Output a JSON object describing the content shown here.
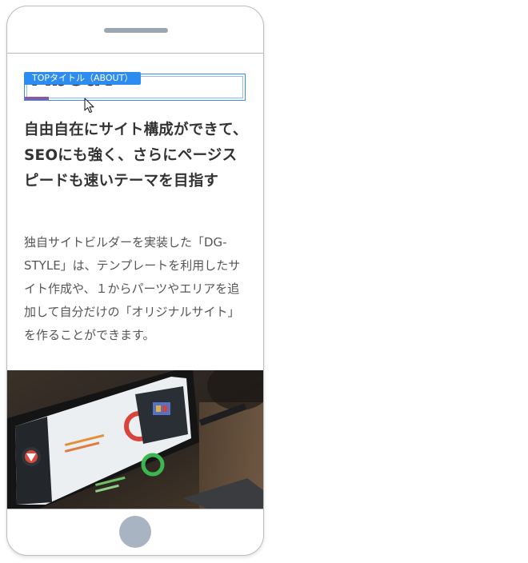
{
  "screen": {
    "about_title": "About",
    "selection_label": "TOPタイトル（ABOUT）",
    "subheading": "自由自在にサイト構成ができて、SEOにも強く、さらにページスピードも速いテーマを目指す",
    "body": "独自サイトビルダーを実装した「DG-STYLE」は、テンプレートを利用したサイト作成や、１からパーツやエリアを追加して自分だけの「オリジナルサイト」を作ることができます。"
  },
  "colors": {
    "selection_blue": "#2d8cf0",
    "accent_purple": "#8a5aa0",
    "phone_frame": "#b9bcc2",
    "home_button": "#a8b4c2",
    "text_dark": "#333333",
    "text_body": "#555555"
  },
  "icons": {
    "speaker": "speaker-slot-icon",
    "home": "home-button-icon",
    "cursor": "mouse-pointer-icon"
  }
}
